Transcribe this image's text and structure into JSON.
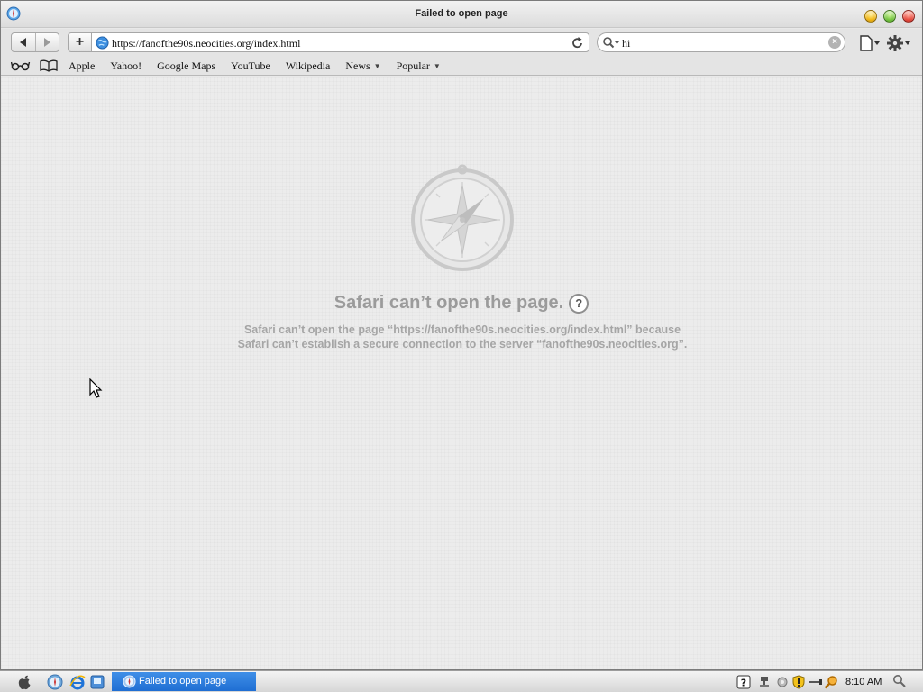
{
  "window": {
    "title": "Failed to open page"
  },
  "toolbar": {
    "back_icon": "back-arrow-icon",
    "forward_icon": "forward-arrow-icon",
    "add_label": "+",
    "url": "https://fanofthe90s.neocities.org/index.html",
    "search_value": "hi"
  },
  "bookmarks_bar": {
    "items": [
      {
        "label": "Apple"
      },
      {
        "label": "Yahoo!"
      },
      {
        "label": "Google Maps"
      },
      {
        "label": "YouTube"
      },
      {
        "label": "Wikipedia"
      },
      {
        "label": "News",
        "has_menu": true
      },
      {
        "label": "Popular",
        "has_menu": true
      }
    ]
  },
  "error_page": {
    "title": "Safari can’t open the page.",
    "help_label": "?",
    "message": "Safari can’t open the page “https://fanofthe90s.neocities.org/index.html” because Safari can’t establish a secure connection to the server “fanofthe90s.neocities.org”."
  },
  "taskbar": {
    "task_label": "Failed to open page",
    "clock": "8:10 AM"
  },
  "colors": {
    "task_button": "#2a7de1",
    "error_text": "#9b9b9b"
  }
}
